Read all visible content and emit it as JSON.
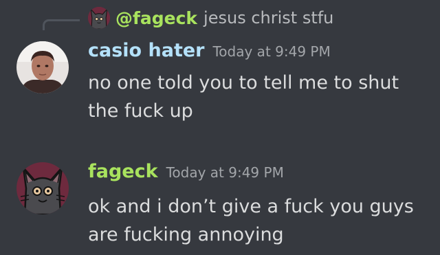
{
  "reply": {
    "author": "@fageck",
    "text": "jesus christ stfu",
    "author_color": "#a9e35e"
  },
  "messages": [
    {
      "author": "casio hater",
      "author_color": "#b4e1fa",
      "timestamp": "Today at 9:49 PM",
      "text": "no one told you to tell me to shut the fuck up",
      "avatar_icon": "user-photo-avatar"
    },
    {
      "author": "fageck",
      "author_color": "#a9e35e",
      "timestamp": "Today at 9:49 PM",
      "text": "ok and i don’t give a fuck you guys are fucking annoying",
      "avatar_icon": "cartoon-cat-avatar"
    }
  ]
}
